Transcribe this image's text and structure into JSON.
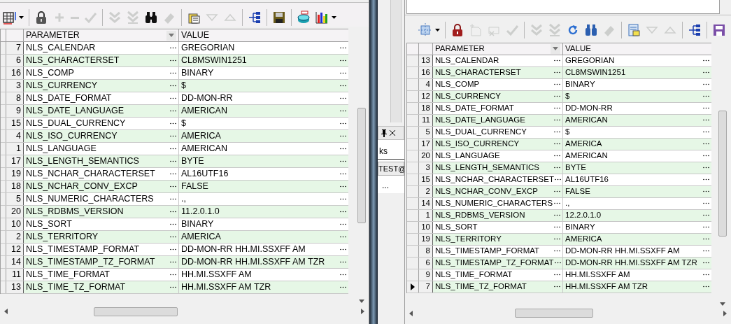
{
  "left_grid": {
    "toolbar": [
      {
        "kind": "grid",
        "disabled": false,
        "caret": true
      },
      {
        "kind": "sep"
      },
      {
        "kind": "lock",
        "disabled": false
      },
      {
        "kind": "plus",
        "disabled": true
      },
      {
        "kind": "minus",
        "disabled": true
      },
      {
        "kind": "check",
        "disabled": true
      },
      {
        "kind": "sep"
      },
      {
        "kind": "first",
        "disabled": true
      },
      {
        "kind": "last",
        "disabled": true
      },
      {
        "kind": "binoculars",
        "disabled": false
      },
      {
        "kind": "eraser",
        "disabled": true
      },
      {
        "kind": "sep"
      },
      {
        "kind": "form",
        "disabled": false
      },
      {
        "kind": "down",
        "disabled": true
      },
      {
        "kind": "up",
        "disabled": true
      },
      {
        "kind": "sep"
      },
      {
        "kind": "tree",
        "disabled": false
      },
      {
        "kind": "sep"
      },
      {
        "kind": "save",
        "disabled": false
      },
      {
        "kind": "sep"
      },
      {
        "kind": "database",
        "disabled": false
      },
      {
        "kind": "chart",
        "disabled": false,
        "caret": true
      }
    ],
    "columns": [
      "PARAMETER",
      "VALUE"
    ],
    "rows": [
      {
        "num": "7",
        "parameter": "NLS_CALENDAR",
        "value": "GREGORIAN"
      },
      {
        "num": "6",
        "parameter": "NLS_CHARACTERSET",
        "value": "CL8MSWIN1251"
      },
      {
        "num": "16",
        "parameter": "NLS_COMP",
        "value": "BINARY"
      },
      {
        "num": "3",
        "parameter": "NLS_CURRENCY",
        "value": "$"
      },
      {
        "num": "8",
        "parameter": "NLS_DATE_FORMAT",
        "value": "DD-MON-RR"
      },
      {
        "num": "9",
        "parameter": "NLS_DATE_LANGUAGE",
        "value": "AMERICAN"
      },
      {
        "num": "15",
        "parameter": "NLS_DUAL_CURRENCY",
        "value": "$"
      },
      {
        "num": "4",
        "parameter": "NLS_ISO_CURRENCY",
        "value": "AMERICA"
      },
      {
        "num": "1",
        "parameter": "NLS_LANGUAGE",
        "value": "AMERICAN"
      },
      {
        "num": "17",
        "parameter": "NLS_LENGTH_SEMANTICS",
        "value": "BYTE"
      },
      {
        "num": "19",
        "parameter": "NLS_NCHAR_CHARACTERSET",
        "value": "AL16UTF16"
      },
      {
        "num": "18",
        "parameter": "NLS_NCHAR_CONV_EXCP",
        "value": "FALSE"
      },
      {
        "num": "5",
        "parameter": "NLS_NUMERIC_CHARACTERS",
        "value": ".,"
      },
      {
        "num": "20",
        "parameter": "NLS_RDBMS_VERSION",
        "value": "11.2.0.1.0"
      },
      {
        "num": "10",
        "parameter": "NLS_SORT",
        "value": "BINARY"
      },
      {
        "num": "2",
        "parameter": "NLS_TERRITORY",
        "value": "AMERICA"
      },
      {
        "num": "12",
        "parameter": "NLS_TIMESTAMP_FORMAT",
        "value": "DD-MON-RR HH.MI.SSXFF AM"
      },
      {
        "num": "14",
        "parameter": "NLS_TIMESTAMP_TZ_FORMAT",
        "value": "DD-MON-RR HH.MI.SSXFF AM TZR"
      },
      {
        "num": "11",
        "parameter": "NLS_TIME_FORMAT",
        "value": "HH.MI.SSXFF AM"
      },
      {
        "num": "13",
        "parameter": "NLS_TIME_TZ_FORMAT",
        "value": "HH.MI.SSXFF AM TZR"
      }
    ]
  },
  "background_panel": {
    "tab_label": "ks",
    "button": "TEST@",
    "more": "..."
  },
  "right_grid": {
    "toolbar": [
      {
        "kind": "select",
        "disabled": false,
        "caret": true
      },
      {
        "kind": "sep"
      },
      {
        "kind": "lock2",
        "disabled": false
      },
      {
        "kind": "newrec",
        "disabled": true
      },
      {
        "kind": "delrec",
        "disabled": true
      },
      {
        "kind": "check",
        "disabled": true
      },
      {
        "kind": "sep"
      },
      {
        "kind": "first",
        "disabled": true
      },
      {
        "kind": "last",
        "disabled": true
      },
      {
        "kind": "refresh",
        "disabled": false
      },
      {
        "kind": "binoculars2",
        "disabled": false
      },
      {
        "kind": "eraser",
        "disabled": true
      },
      {
        "kind": "sep"
      },
      {
        "kind": "form2",
        "disabled": false
      },
      {
        "kind": "down",
        "disabled": true
      },
      {
        "kind": "up",
        "disabled": true
      },
      {
        "kind": "sep"
      },
      {
        "kind": "tree",
        "disabled": false
      },
      {
        "kind": "sep"
      },
      {
        "kind": "save2",
        "disabled": false
      }
    ],
    "columns": [
      "PARAMETER",
      "VALUE"
    ],
    "rows": [
      {
        "num": "13",
        "parameter": "NLS_CALENDAR",
        "value": "GREGORIAN",
        "selected": false
      },
      {
        "num": "16",
        "parameter": "NLS_CHARACTERSET",
        "value": "CL8MSWIN1251",
        "selected": false
      },
      {
        "num": "4",
        "parameter": "NLS_COMP",
        "value": "BINARY",
        "selected": false
      },
      {
        "num": "12",
        "parameter": "NLS_CURRENCY",
        "value": "$",
        "selected": false
      },
      {
        "num": "18",
        "parameter": "NLS_DATE_FORMAT",
        "value": "DD-MON-RR",
        "selected": false
      },
      {
        "num": "11",
        "parameter": "NLS_DATE_LANGUAGE",
        "value": "AMERICAN",
        "selected": false
      },
      {
        "num": "5",
        "parameter": "NLS_DUAL_CURRENCY",
        "value": "$",
        "selected": false
      },
      {
        "num": "17",
        "parameter": "NLS_ISO_CURRENCY",
        "value": "AMERICA",
        "selected": false
      },
      {
        "num": "20",
        "parameter": "NLS_LANGUAGE",
        "value": "AMERICAN",
        "selected": false
      },
      {
        "num": "3",
        "parameter": "NLS_LENGTH_SEMANTICS",
        "value": "BYTE",
        "selected": false
      },
      {
        "num": "15",
        "parameter": "NLS_NCHAR_CHARACTERSET",
        "value": "AL16UTF16",
        "selected": false
      },
      {
        "num": "2",
        "parameter": "NLS_NCHAR_CONV_EXCP",
        "value": "FALSE",
        "selected": false
      },
      {
        "num": "14",
        "parameter": "NLS_NUMERIC_CHARACTERS",
        "value": ".,",
        "selected": false
      },
      {
        "num": "1",
        "parameter": "NLS_RDBMS_VERSION",
        "value": "12.2.0.1.0",
        "selected": false
      },
      {
        "num": "10",
        "parameter": "NLS_SORT",
        "value": "BINARY",
        "selected": false
      },
      {
        "num": "19",
        "parameter": "NLS_TERRITORY",
        "value": "AMERICA",
        "selected": false
      },
      {
        "num": "8",
        "parameter": "NLS_TIMESTAMP_FORMAT",
        "value": "DD-MON-RR HH.MI.SSXFF AM",
        "selected": false
      },
      {
        "num": "6",
        "parameter": "NLS_TIMESTAMP_TZ_FORMAT",
        "value": "DD-MON-RR HH.MI.SSXFF AM TZR",
        "selected": false
      },
      {
        "num": "9",
        "parameter": "NLS_TIME_FORMAT",
        "value": "HH.MI.SSXFF AM",
        "selected": false
      },
      {
        "num": "7",
        "parameter": "NLS_TIME_TZ_FORMAT",
        "value": "HH.MI.SSXFF AM TZR",
        "selected": true
      }
    ]
  }
}
